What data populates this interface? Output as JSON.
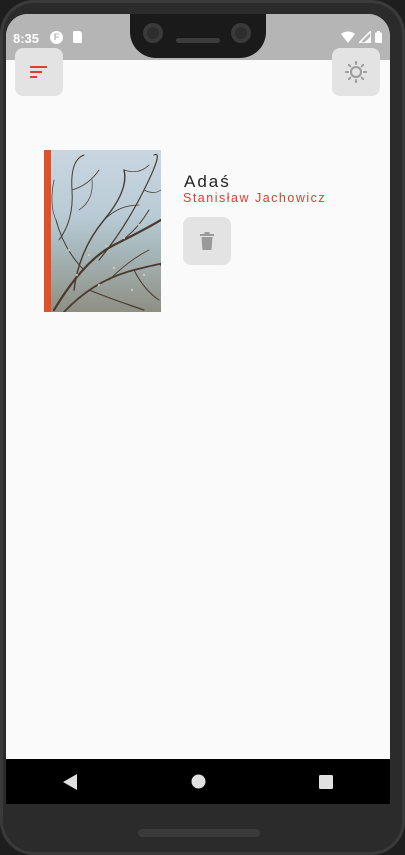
{
  "status_bar": {
    "time": "8:35",
    "left_icons": [
      "f-app-icon",
      "sd-card-icon"
    ],
    "right_icons": [
      "wifi-icon",
      "cell-signal-icon",
      "battery-icon"
    ]
  },
  "app_bar": {
    "sort_icon": "sort-icon",
    "theme_icon": "brightness-icon",
    "accent_color": "#e53935"
  },
  "book": {
    "title": "Adaś",
    "author": "Stanisław Jachowicz",
    "cover_image": "tree-branches-cover",
    "cover_spine_color": "#e0512a",
    "delete_icon": "trash-icon"
  },
  "nav_bar": {
    "items": [
      "back-triangle-icon",
      "home-circle-icon",
      "recents-square-icon"
    ]
  }
}
